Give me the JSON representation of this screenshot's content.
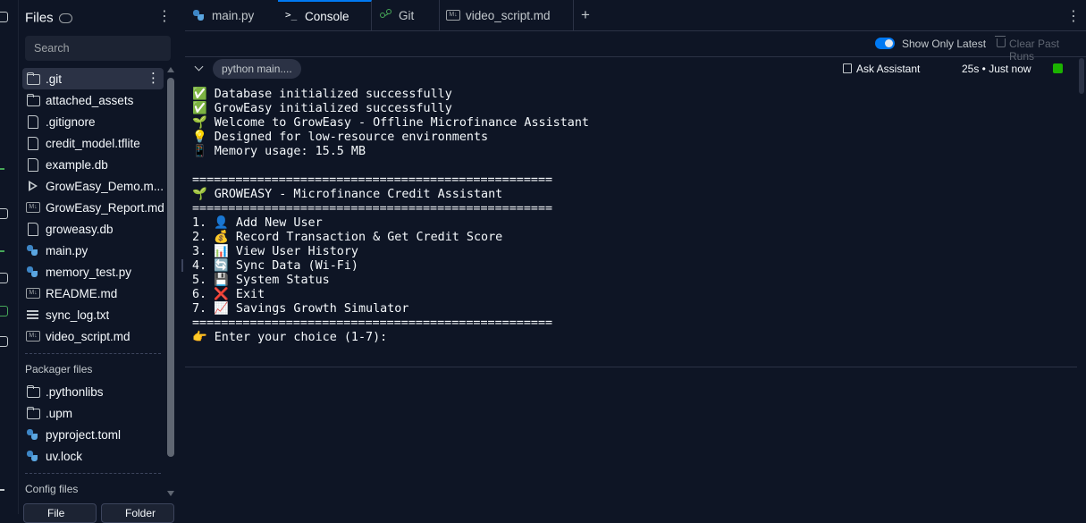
{
  "files_panel": {
    "title": "Files",
    "search_placeholder": "Search",
    "items": [
      {
        "name": ".git",
        "icon": "folder-icon"
      },
      {
        "name": "attached_assets",
        "icon": "folder-icon"
      },
      {
        "name": ".gitignore",
        "icon": "file-icon"
      },
      {
        "name": "credit_model.tflite",
        "icon": "file-icon"
      },
      {
        "name": "example.db",
        "icon": "file-icon"
      },
      {
        "name": "GrowEasy_Demo.m...",
        "icon": "play-icon"
      },
      {
        "name": "GrowEasy_Report.md",
        "icon": "markdown-icon"
      },
      {
        "name": "groweasy.db",
        "icon": "file-icon"
      },
      {
        "name": "main.py",
        "icon": "python-icon"
      },
      {
        "name": "memory_test.py",
        "icon": "python-icon"
      },
      {
        "name": "README.md",
        "icon": "markdown-icon"
      },
      {
        "name": "sync_log.txt",
        "icon": "text-file-icon"
      },
      {
        "name": "video_script.md",
        "icon": "markdown-icon"
      }
    ],
    "packager_title": "Packager files",
    "packager_items": [
      {
        "name": ".pythonlibs",
        "icon": "folder-icon"
      },
      {
        "name": ".upm",
        "icon": "folder-icon"
      },
      {
        "name": "pyproject.toml",
        "icon": "python-icon"
      },
      {
        "name": "uv.lock",
        "icon": "python-icon"
      }
    ],
    "config_title": "Config files",
    "bottom_buttons": [
      "File",
      "Folder"
    ]
  },
  "tabs": [
    {
      "label": "main.py",
      "icon": "python-icon"
    },
    {
      "label": "Console",
      "icon": "console-icon",
      "active": true
    },
    {
      "label": "Git",
      "icon": "git-icon"
    },
    {
      "label": "video_script.md",
      "icon": "markdown-icon"
    }
  ],
  "console_toolbar": {
    "show_only_latest": "Show Only Latest",
    "show_only_latest_on": true,
    "clear_past_runs": "Clear Past Runs"
  },
  "run": {
    "command": "python main....",
    "ask_assistant": "Ask Assistant",
    "duration": "25s • Just now",
    "status_color": "#1bb300"
  },
  "terminal_lines": [
    "✅ Database initialized successfully",
    "✅ GrowEasy initialized successfully",
    "🌱 Welcome to GrowEasy - Offline Microfinance Assistant",
    "💡 Designed for low-resource environments",
    "📱 Memory usage: 15.5 MB",
    "",
    "==================================================",
    "🌱 GROWEASY - Microfinance Credit Assistant",
    "==================================================",
    "1. 👤 Add New User",
    "2. 💰 Record Transaction & Get Credit Score",
    "3. 📊 View User History",
    "4. 🔄 Sync Data (Wi-Fi)",
    "5. 💾 System Status",
    "6. ❌ Exit",
    "7. 📈 Savings Growth Simulator",
    "==================================================",
    "👉 Enter your choice (1-7):"
  ],
  "colors": {
    "background": "#0e1525",
    "accent": "#0079f2",
    "text": "#f5f9fc",
    "muted": "#9da2a6"
  }
}
